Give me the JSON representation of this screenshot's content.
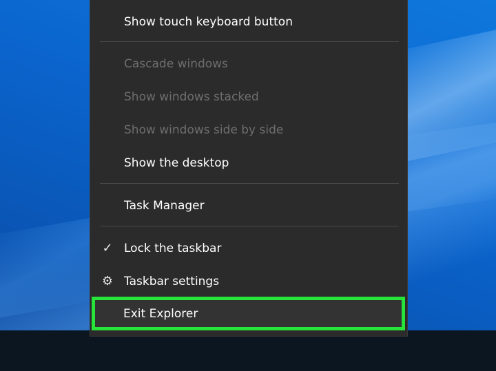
{
  "context_menu": {
    "items": [
      {
        "label": "Show touch keyboard button",
        "enabled": true
      },
      {
        "label": "Cascade windows",
        "enabled": false
      },
      {
        "label": "Show windows stacked",
        "enabled": false
      },
      {
        "label": "Show windows side by side",
        "enabled": false
      },
      {
        "label": "Show the desktop",
        "enabled": true
      },
      {
        "label": "Task Manager",
        "enabled": true
      },
      {
        "label": "Lock the taskbar",
        "enabled": true,
        "checked": true,
        "icon": "checkmark-icon"
      },
      {
        "label": "Taskbar settings",
        "enabled": true,
        "icon": "gear-icon"
      },
      {
        "label": "Exit Explorer",
        "enabled": true,
        "highlighted": true
      }
    ],
    "icon_glyphs": {
      "check": "✓",
      "gear": "⚙"
    }
  },
  "colors": {
    "menu_background": "#2b2b2b",
    "highlight_border": "#27e33a",
    "disabled_text": "#6e6e6e",
    "desktop_blue": "#0a63c9",
    "taskbar": "#0b1620"
  }
}
